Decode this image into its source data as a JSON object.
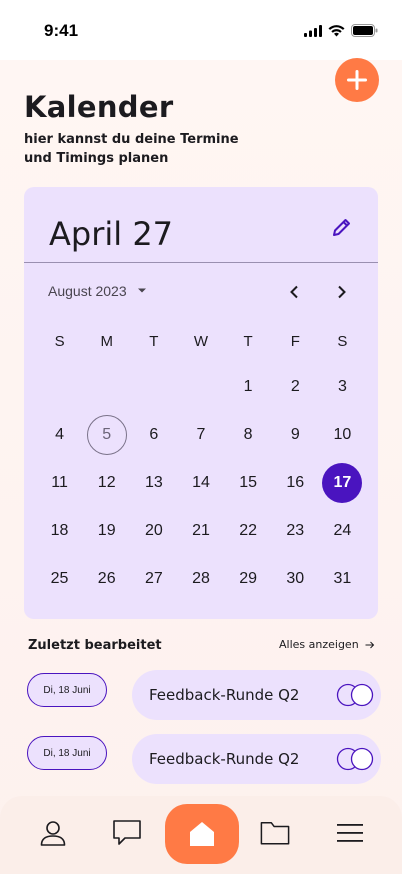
{
  "status_bar": {
    "time": "9:41"
  },
  "header": {
    "title": "Kalender",
    "subtitle": "hier kannst du deine Termine und Timings planen"
  },
  "calendar": {
    "selected_date_label": "April 27",
    "month_label": "August 2023",
    "weekdays": [
      "S",
      "M",
      "T",
      "W",
      "T",
      "F",
      "S"
    ],
    "leading_blanks": 4,
    "days": [
      "1",
      "2",
      "3",
      "4",
      "5",
      "6",
      "7",
      "8",
      "9",
      "10",
      "11",
      "12",
      "13",
      "14",
      "15",
      "16",
      "17",
      "18",
      "19",
      "20",
      "21",
      "22",
      "23",
      "24",
      "25",
      "26",
      "27",
      "28",
      "29",
      "30",
      "31"
    ],
    "today": "5",
    "selected": "17"
  },
  "recent": {
    "title": "Zuletzt bearbeitet",
    "show_all": "Alles anzeigen",
    "entries": [
      {
        "date": "Di, 18 Juni",
        "label": "Feedback-Runde Q2"
      },
      {
        "date": "Di, 18 Juni",
        "label": "Feedback-Runde Q2"
      }
    ]
  },
  "colors": {
    "accent": "#ff7a45",
    "primary": "#4a14bf",
    "card": "#ece1fd"
  },
  "nav": {
    "items": [
      "profile-icon",
      "chat-icon",
      "home-icon",
      "folder-icon",
      "menu-icon"
    ]
  }
}
